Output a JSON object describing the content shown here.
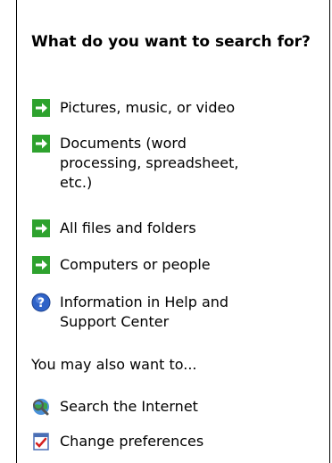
{
  "search_panel": {
    "heading": "What do you want to search for?",
    "items": [
      {
        "label": "Pictures, music, or video",
        "icon": "green-arrow-icon"
      },
      {
        "label": "Documents (word processing, spreadsheet, etc.)",
        "icon": "green-arrow-icon"
      },
      {
        "label": "All files and folders",
        "icon": "green-arrow-icon"
      },
      {
        "label": "Computers or people",
        "icon": "green-arrow-icon"
      },
      {
        "label": "Information in Help and Support Center",
        "icon": "help-icon"
      }
    ],
    "also_heading": "You may also want to...",
    "also_items": [
      {
        "label": "Search the Internet",
        "icon": "internet-search-icon"
      },
      {
        "label": "Change preferences",
        "icon": "preferences-icon"
      }
    ]
  },
  "colors": {
    "arrow_green": "#2ea22e",
    "help_blue": "#2f63c8",
    "border": "#000000"
  }
}
